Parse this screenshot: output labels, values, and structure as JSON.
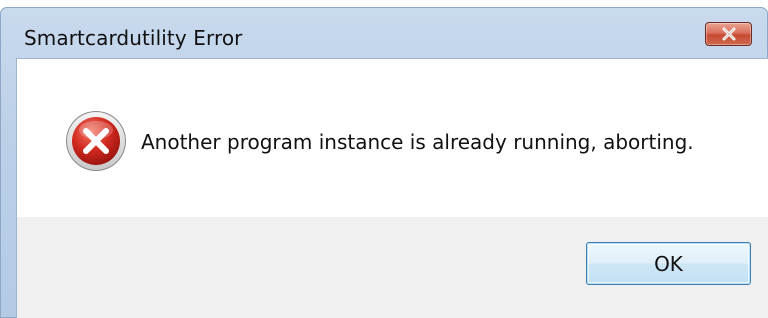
{
  "window": {
    "title": "Smartcardutility Error"
  },
  "dialog": {
    "message": "Another program instance is already running, aborting.",
    "icon": "error-icon",
    "ok_label": "OK"
  },
  "colors": {
    "close_button": "#c74a32",
    "error_icon": "#c8201a"
  }
}
